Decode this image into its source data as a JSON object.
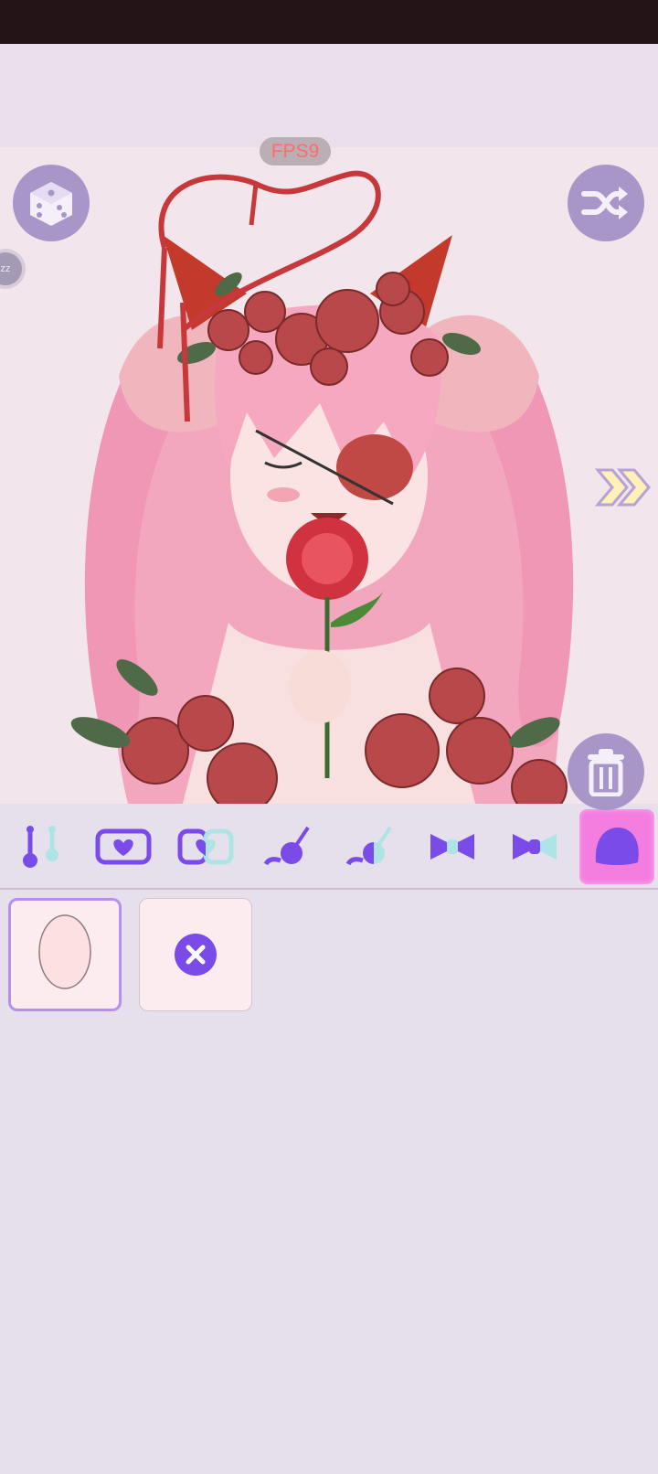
{
  "overlay": {
    "fps_label": "FPS9",
    "sleep_label": "zz"
  },
  "canvas": {
    "left_button": "random-dice",
    "right_button": "shuffle",
    "next_button": "double-chevron-right",
    "delete_button": "trash"
  },
  "toolbar": {
    "tools": [
      "slider-toggle-icon",
      "heart-frame-icon",
      "heart-frame-split-icon",
      "bubble-wand-icon",
      "bubble-wand-split-icon",
      "bow-icon",
      "bow-split-icon",
      "blob-shape-icon"
    ],
    "active_index": 7
  },
  "panel": {
    "items": [
      {
        "name": "face-shape-option",
        "selected": true
      },
      {
        "name": "none-option",
        "selected": false
      }
    ]
  },
  "colors": {
    "accent": "#a996c9",
    "tool_purple": "#7a4be8",
    "tool_mint": "#aee4e6",
    "active_tab": "#f37ee0",
    "status_bar": "#241316"
  }
}
